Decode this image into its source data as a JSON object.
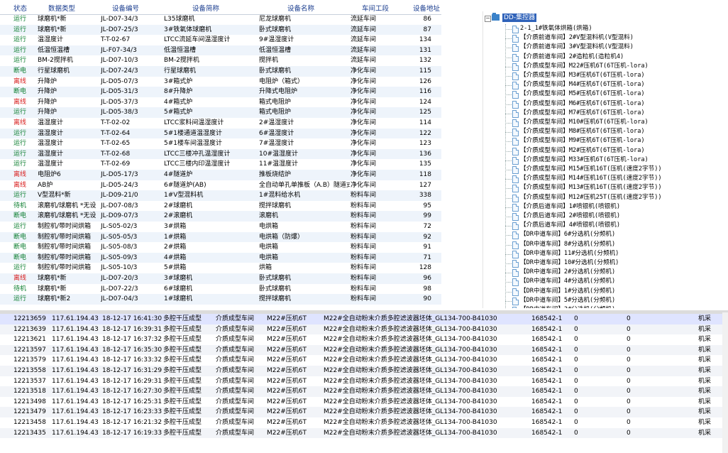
{
  "device_table": {
    "columns": [
      "状态",
      "数据类型",
      "设备编号",
      "设备简称",
      "设备名称",
      "车间工段",
      "设备地址"
    ],
    "rows": [
      [
        "运行",
        "球磨机*新",
        "JL-D07-34/3",
        "L35球磨机",
        "尼龙球磨机",
        "流延车间",
        "86"
      ],
      [
        "运行",
        "球磨机*新",
        "JL-D07-25/3",
        "3#铁氧体球磨机",
        "卧式球磨机",
        "流延车间",
        "87"
      ],
      [
        "运行",
        "温湿度计",
        "T-T-02-67",
        "LTCC流延车间温湿度计",
        "9#温湿度计",
        "流延车间",
        "134"
      ],
      [
        "运行",
        "低温恒温槽",
        "JL-F07-34/3",
        "低温恒温槽",
        "低温恒温槽",
        "流延车间",
        "131"
      ],
      [
        "运行",
        "BM-2搅拌机",
        "JL-D07-10/3",
        "BM-2搅拌机",
        "搅拌机",
        "流延车间",
        "132"
      ],
      [
        "断电",
        "行星球磨机",
        "JL-D07-24/3",
        "行星球磨机",
        "卧式球磨机",
        "净化车间",
        "115"
      ],
      [
        "离线",
        "升降炉",
        "JL-D05-07/3",
        "3#箱式炉",
        "电阻炉（箱式）",
        "净化车间",
        "126"
      ],
      [
        "断电",
        "升降炉",
        "JL-D05-31/3",
        "8#升降炉",
        "升降式电阻炉",
        "净化车间",
        "116"
      ],
      [
        "离线",
        "升降炉",
        "JL-D05-37/3",
        "4#箱式炉",
        "箱式电阻炉",
        "净化车间",
        "124"
      ],
      [
        "运行",
        "升降炉",
        "JL-D05-38/3",
        "5#箱式炉",
        "箱式电阻炉",
        "净化车间",
        "125"
      ],
      [
        "离线",
        "温湿度计",
        "T-T-02-02",
        "LTCC浆料间温湿度计",
        "2#温湿度计",
        "净化车间",
        "114"
      ],
      [
        "运行",
        "温湿度计",
        "T-T-02-64",
        "5#1楼通道温湿度计",
        "6#温湿度计",
        "净化车间",
        "122"
      ],
      [
        "运行",
        "温湿度计",
        "T-T-02-65",
        "5#1楼车间温湿度计",
        "7#温湿度计",
        "净化车间",
        "123"
      ],
      [
        "运行",
        "温湿度计",
        "T-T-02-68",
        "LTCC三楼冲孔温湿度计",
        "10#温湿度计",
        "净化车间",
        "136"
      ],
      [
        "运行",
        "温湿度计",
        "T-T-02-69",
        "LTCC三楼内印温湿度计",
        "11#温湿度计",
        "净化车间",
        "135"
      ],
      [
        "离线",
        "电阻炉6",
        "JL-D05-17/3",
        "4#隧道炉",
        "推板烧结炉",
        "净化车间",
        "118"
      ],
      [
        "离线",
        "AB炉",
        "JL-D05-24/3",
        "6#隧道炉(AB)",
        "全自动单孔单推板（A.B）隧道式",
        "净化车间",
        "127"
      ],
      [
        "运行",
        "V型混料*新",
        "JL-D09-21/0",
        "1#V型混料机",
        "1#混料给水机",
        "粉料车间",
        "338"
      ],
      [
        "待机",
        "滚磨机/球磨机 *无设",
        "JL-D07-08/3",
        "2#球磨机",
        "搅拌球磨机",
        "粉料车间",
        "95"
      ],
      [
        "断电",
        "滚磨机/球磨机 *无设",
        "JL-D09-07/3",
        "2#滚磨机",
        "滚磨机",
        "粉料车间",
        "99"
      ],
      [
        "运行",
        "制腔机/带时间烘箱",
        "JL-S05-02/3",
        "3#烘箱",
        "电烘箱",
        "粉料车间",
        "72"
      ],
      [
        "断电",
        "制腔机/带时间烘箱",
        "JL-S05-05/3",
        "1#烘箱",
        "电烘箱（防爆）",
        "粉料车间",
        "92"
      ],
      [
        "断电",
        "制腔机/带时间烘箱",
        "JL-S05-08/3",
        "2#烘箱",
        "电烘箱",
        "粉料车间",
        "91"
      ],
      [
        "断电",
        "制腔机/带时间烘箱",
        "JL-S05-09/3",
        "4#烘箱",
        "电烘箱",
        "粉料车间",
        "71"
      ],
      [
        "运行",
        "制腔机/带时间烘箱",
        "JL-S05-10/3",
        "5#烘箱",
        "烘箱",
        "粉料车间",
        "128"
      ],
      [
        "离线",
        "球磨机*新",
        "JL-D07-20/3",
        "3#球磨机",
        "卧式球磨机",
        "粉料车间",
        "96"
      ],
      [
        "待机",
        "球磨机*新",
        "JL-D07-22/3",
        "6#球磨机",
        "卧式球磨机",
        "粉料车间",
        "98"
      ],
      [
        "运行",
        "球磨机*新2",
        "JL-D07-04/3",
        "1#球磨机",
        "搅拌球磨机",
        "粉料车间",
        "90"
      ]
    ]
  },
  "tree": {
    "root": "DD-集控器",
    "root_toggle": "−",
    "items": [
      "2-1_1#铁氧体烘箱(烘箱)",
      "【介质前道车间】2#V型混料机(V型混料)",
      "【介质前道车间】3#V型混料机(V型混料)",
      "【介质前道车间】2#造粒机(造粒机4)",
      "【介质成型车间】M22#压机6T(6T压机-lora)",
      "【介质成型车间】M3#压机6T(6T压机-lora)",
      "【介质成型车间】M4#压机6T(6T压机-lora)",
      "【介质成型车间】M5#压机6T(6T压机-lora)",
      "【介质成型车间】M6#压机6T(6T压机-lora)",
      "【介质成型车间】M7#压机6T(6T压机-lora)",
      "【介质成型车间】M10#压机6T(6T压机-lora)",
      "【介质成型车间】M8#压机6T(6T压机-lora)",
      "【介质成型车间】M9#压机6T(6T压机-lora)",
      "【介质成型车间】M2#压机6T(6T压机-lora)",
      "【介质成型车间】M33#压机6T(6T压机-lora)",
      "【介质成型车间】M15#压机16T(压机(速度2字节))",
      "【介质成型车间】M14#压机16T(压机(速度2字节))",
      "【介质成型车间】M13#压机16T(压机(速度2字节))",
      "【介质成型车间】M12#压机25T(压机(速度2字节))",
      "【介质后道车间】1#喷银机(喷银机)",
      "【介质后道车间】2#喷银机(喷银机)",
      "【介质后道车间】4#喷银机(喷银机)",
      "【DR中道车间】6#分选机(分频机)",
      "【DR中道车间】8#分选机(分频机)",
      "【DR中道车间】11#分选机(分频机)",
      "【DR中道车间】10#分选机(分频机)",
      "【DR中道车间】2#分选机(分频机)",
      "【DR中道车间】4#分选机(分频机)",
      "【DR中道车间】1#分选机(分频机)",
      "【DR中道车间】5#分选机(分频机)",
      "【DR中道车间】3#分选机(分频机)"
    ]
  },
  "records": {
    "rows": [
      [
        "12213659",
        "117.61.194.43",
        "18-12-17 16:41:30",
        "多腔干压成型",
        "介质成型车间",
        "M22#压机6T",
        "M22#全自动粉末介质多腔滤波器坯体_GL134-700-B41030",
        "168542-1",
        "0",
        "0",
        "机采"
      ],
      [
        "12213639",
        "117.61.194.43",
        "18-12-17 16:39:31",
        "多腔干压成型",
        "介质成型车间",
        "M22#压机6T",
        "M22#全自动粉末介质多腔滤波器坯体_GL134-700-B41030",
        "168542-1",
        "0",
        "0",
        "机采"
      ],
      [
        "12213621",
        "117.61.194.43",
        "18-12-17 16:37:32",
        "多腔干压成型",
        "介质成型车间",
        "M22#压机6T",
        "M22#全自动粉末介质多腔滤波器坯体_GL134-700-B41030",
        "168542-1",
        "0",
        "0",
        "机采"
      ],
      [
        "12213597",
        "117.61.194.43",
        "18-12-17 16:35:30",
        "多腔干压成型",
        "介质成型车间",
        "M22#压机6T",
        "M22#全自动粉末介质多腔滤波器坯体_GL134-700-B41030",
        "168542-1",
        "0",
        "0",
        "机采"
      ],
      [
        "12213579",
        "117.61.194.43",
        "18-12-17 16:33:32",
        "多腔干压成型",
        "介质成型车间",
        "M22#压机6T",
        "M22#全自动粉末介质多腔滤波器坯体_GL134-700-B41030",
        "168542-1",
        "0",
        "0",
        "机采"
      ],
      [
        "12213558",
        "117.61.194.43",
        "18-12-17 16:31:29",
        "多腔干压成型",
        "介质成型车间",
        "M22#压机6T",
        "M22#全自动粉末介质多腔滤波器坯体_GL134-700-B41030",
        "168542-1",
        "0",
        "0",
        "机采"
      ],
      [
        "12213537",
        "117.61.194.43",
        "18-12-17 16:29:31",
        "多腔干压成型",
        "介质成型车间",
        "M22#压机6T",
        "M22#全自动粉末介质多腔滤波器坯体_GL134-700-B41030",
        "168542-1",
        "0",
        "0",
        "机采"
      ],
      [
        "12213518",
        "117.61.194.43",
        "18-12-17 16:27:30",
        "多腔干压成型",
        "介质成型车间",
        "M22#压机6T",
        "M22#全自动粉末介质多腔滤波器坯体_GL134-700-B41030",
        "168542-1",
        "0",
        "0",
        "机采"
      ],
      [
        "12213498",
        "117.61.194.43",
        "18-12-17 16:25:31",
        "多腔干压成型",
        "介质成型车间",
        "M22#压机6T",
        "M22#全自动粉末介质多腔滤波器坯体_GL134-700-B41030",
        "168542-1",
        "0",
        "0",
        "机采"
      ],
      [
        "12213479",
        "117.61.194.43",
        "18-12-17 16:23:33",
        "多腔干压成型",
        "介质成型车间",
        "M22#压机6T",
        "M22#全自动粉末介质多腔滤波器坯体_GL134-700-B41030",
        "168542-1",
        "0",
        "0",
        "机采"
      ],
      [
        "12213458",
        "117.61.194.43",
        "18-12-17 16:21:32",
        "多腔干压成型",
        "介质成型车间",
        "M22#压机6T",
        "M22#全自动粉末介质多腔滤波器坯体_GL134-700-B41030",
        "168542-1",
        "0",
        "0",
        "机采"
      ],
      [
        "12213435",
        "117.61.194.43",
        "18-12-17 16:19:33",
        "多腔干压成型",
        "介质成型车间",
        "M22#压机6T",
        "M22#全自动粉末介质多腔滤波器坯体_GL134-700-B41030",
        "168542-1",
        "0",
        "0",
        "机采"
      ]
    ]
  },
  "colors": {
    "status_running": "#0a7d2e",
    "status_offline": "#d81d1d",
    "header_text": "#1a3d8f",
    "tree_selected_bg": "#2f62b9",
    "records_selected_bg": "#dfe4ff"
  }
}
